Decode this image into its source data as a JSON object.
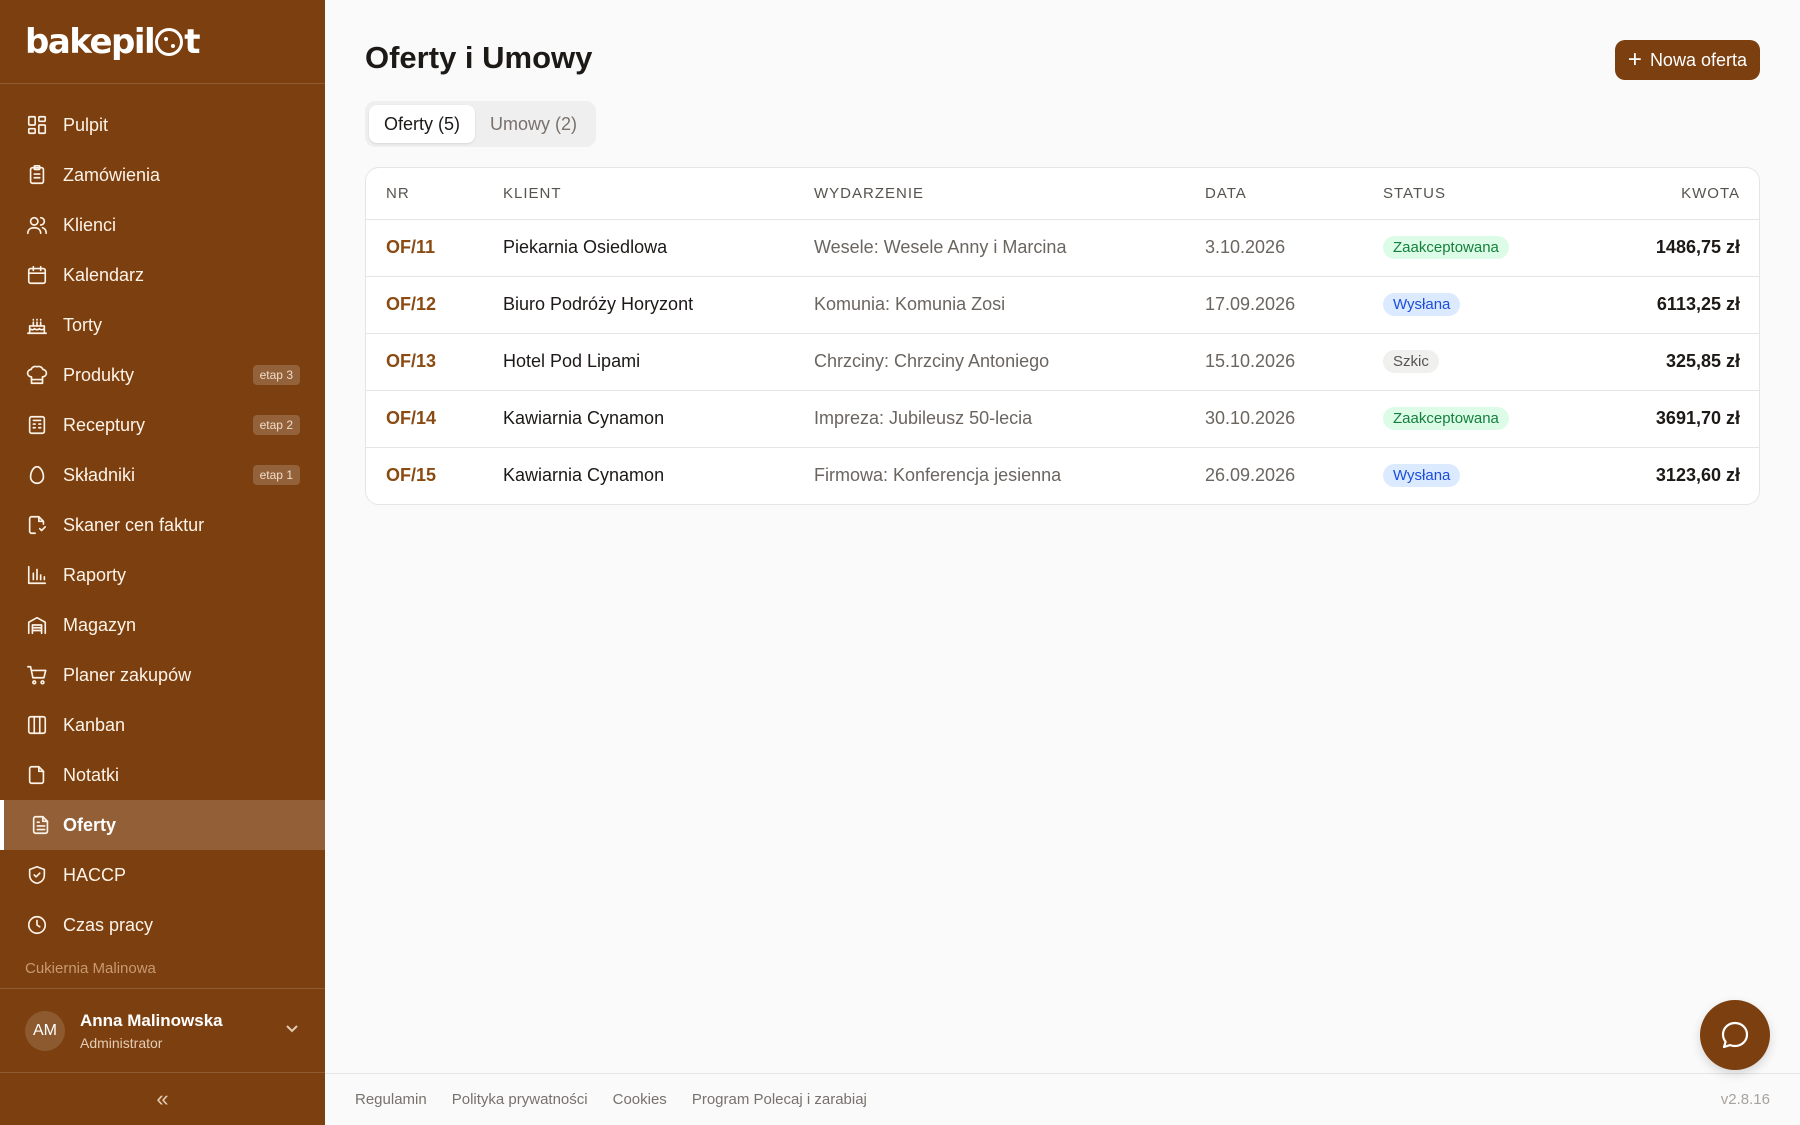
{
  "brand": {
    "part1": "bakepil",
    "part2": "t"
  },
  "sidebar": {
    "items": [
      {
        "label": "Pulpit",
        "icon": "dashboard-icon",
        "badge": ""
      },
      {
        "label": "Zamówienia",
        "icon": "clipboard-icon",
        "badge": ""
      },
      {
        "label": "Klienci",
        "icon": "users-icon",
        "badge": ""
      },
      {
        "label": "Kalendarz",
        "icon": "calendar-icon",
        "badge": ""
      },
      {
        "label": "Torty",
        "icon": "cake-icon",
        "badge": ""
      },
      {
        "label": "Produkty",
        "icon": "chef-hat-icon",
        "badge": "etap 3"
      },
      {
        "label": "Receptury",
        "icon": "recipe-book-icon",
        "badge": "etap 2"
      },
      {
        "label": "Składniki",
        "icon": "egg-icon",
        "badge": "etap 1"
      },
      {
        "label": "Skaner cen faktur",
        "icon": "document-scan-icon",
        "badge": ""
      },
      {
        "label": "Raporty",
        "icon": "bar-chart-icon",
        "badge": ""
      },
      {
        "label": "Magazyn",
        "icon": "warehouse-icon",
        "badge": ""
      },
      {
        "label": "Planer zakupów",
        "icon": "cart-icon",
        "badge": ""
      },
      {
        "label": "Kanban",
        "icon": "kanban-icon",
        "badge": ""
      },
      {
        "label": "Notatki",
        "icon": "note-icon",
        "badge": ""
      },
      {
        "label": "Oferty",
        "icon": "file-text-icon",
        "badge": "",
        "active": true
      },
      {
        "label": "HACCP",
        "icon": "shield-check-icon",
        "badge": ""
      },
      {
        "label": "Czas pracy",
        "icon": "clock-icon",
        "badge": ""
      }
    ],
    "org_name": "Cukiernia Malinowa",
    "user": {
      "initials": "AM",
      "name": "Anna Malinowska",
      "role": "Administrator"
    },
    "collapse_label": "«"
  },
  "main": {
    "title": "Oferty i Umowy",
    "new_button": "Nowa oferta",
    "tabs": [
      {
        "label": "Oferty (5)",
        "active": true
      },
      {
        "label": "Umowy (2)",
        "active": false
      }
    ],
    "table": {
      "headers": [
        "NR",
        "KLIENT",
        "WYDARZENIE",
        "DATA",
        "STATUS",
        "KWOTA"
      ],
      "rows": [
        {
          "nr": "OF/11",
          "klient": "Piekarnia Osiedlowa",
          "event": "Wesele: Wesele Anny i Marcina",
          "data": "3.10.2026",
          "status": "Zaakceptowana",
          "status_kind": "green",
          "kwota": "1486,75 zł"
        },
        {
          "nr": "OF/12",
          "klient": "Biuro Podróży Horyzont",
          "event": "Komunia: Komunia Zosi",
          "data": "17.09.2026",
          "status": "Wysłana",
          "status_kind": "blue",
          "kwota": "6113,25 zł"
        },
        {
          "nr": "OF/13",
          "klient": "Hotel Pod Lipami",
          "event": "Chrzciny: Chrzciny Antoniego",
          "data": "15.10.2026",
          "status": "Szkic",
          "status_kind": "gray",
          "kwota": "325,85 zł"
        },
        {
          "nr": "OF/14",
          "klient": "Kawiarnia Cynamon",
          "event": "Impreza: Jubileusz 50-lecia",
          "data": "30.10.2026",
          "status": "Zaakceptowana",
          "status_kind": "green",
          "kwota": "3691,70 zł"
        },
        {
          "nr": "OF/15",
          "klient": "Kawiarnia Cynamon",
          "event": "Firmowa: Konferencja jesienna",
          "data": "26.09.2026",
          "status": "Wysłana",
          "status_kind": "blue",
          "kwota": "3123,60 zł"
        }
      ]
    }
  },
  "footer": {
    "links": [
      "Regulamin",
      "Polityka prywatności",
      "Cookies",
      "Program Polecaj i zarabiaj"
    ],
    "version": "v2.8.16"
  },
  "colors": {
    "brand": "#7c3f0f",
    "accepted": "#15803d",
    "sent": "#1d4ed8"
  }
}
